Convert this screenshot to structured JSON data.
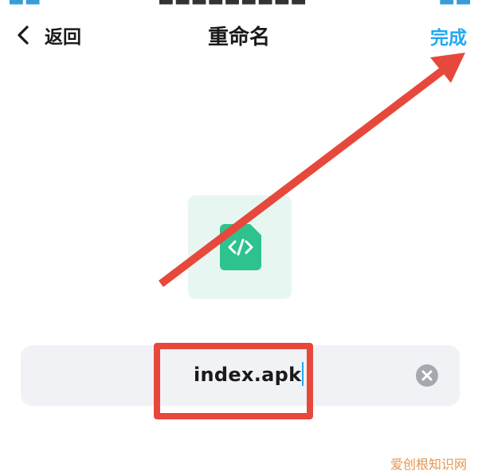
{
  "nav": {
    "back_label": "返回",
    "title": "重命名",
    "done_label": "完成"
  },
  "file": {
    "name": "index.apk",
    "icon": "code-file-icon"
  },
  "icons": {
    "back": "chevron-left-icon",
    "clear": "clear-circle-icon"
  },
  "colors": {
    "accent": "#22a8f0",
    "annotation": "#e7483c",
    "icon_green": "#2ec28f",
    "icon_bg": "#e8f6f2",
    "input_bg": "#f1f2f6"
  },
  "watermark": "爱创根知识网"
}
